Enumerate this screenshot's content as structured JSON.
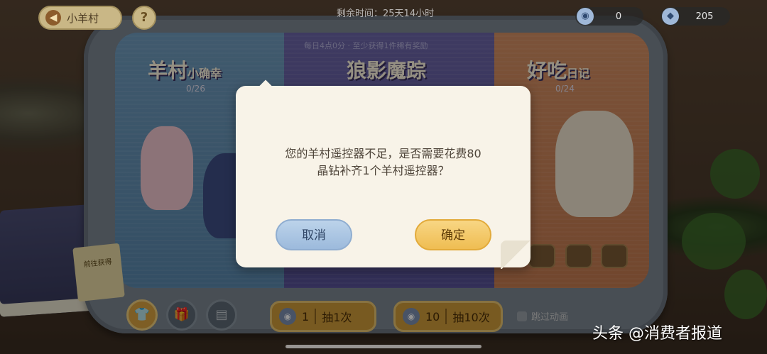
{
  "header": {
    "back_label": "小羊村",
    "help_icon": "?",
    "timer_text": "剩余时间：25天14小时",
    "currency_1": {
      "icon": "remote-icon",
      "value": "0"
    },
    "currency_2": {
      "icon": "crystal-icon",
      "value": "205"
    }
  },
  "screen": {
    "notice": "每日4点0分 · 至少获得1件稀有奖励",
    "panels": [
      {
        "title": "羊村",
        "subtitle": "小确幸",
        "progress": "0/26"
      },
      {
        "title": "狼影魔踪",
        "subtitle": "",
        "progress": ""
      },
      {
        "title": "好吃",
        "subtitle": "日记",
        "progress": "0/24"
      }
    ],
    "badge": "1次",
    "side_note": "前往获得"
  },
  "dialog": {
    "message_line1": "您的羊村遥控器不足，是否需要花费80",
    "message_line2": "晶钻补齐1个羊村遥控器？",
    "cancel_label": "取消",
    "confirm_label": "确定"
  },
  "controls": {
    "draw_one": {
      "count": "1",
      "label": "抽1次"
    },
    "draw_ten": {
      "count": "10",
      "label": "抽10次"
    },
    "skip_label": "跳过动画"
  },
  "watermark": "头条 @消费者报道",
  "colors": {
    "cancel_button": "#9cbadc",
    "confirm_button": "#efbd52",
    "dialog_bg": "#f8f3e8"
  }
}
